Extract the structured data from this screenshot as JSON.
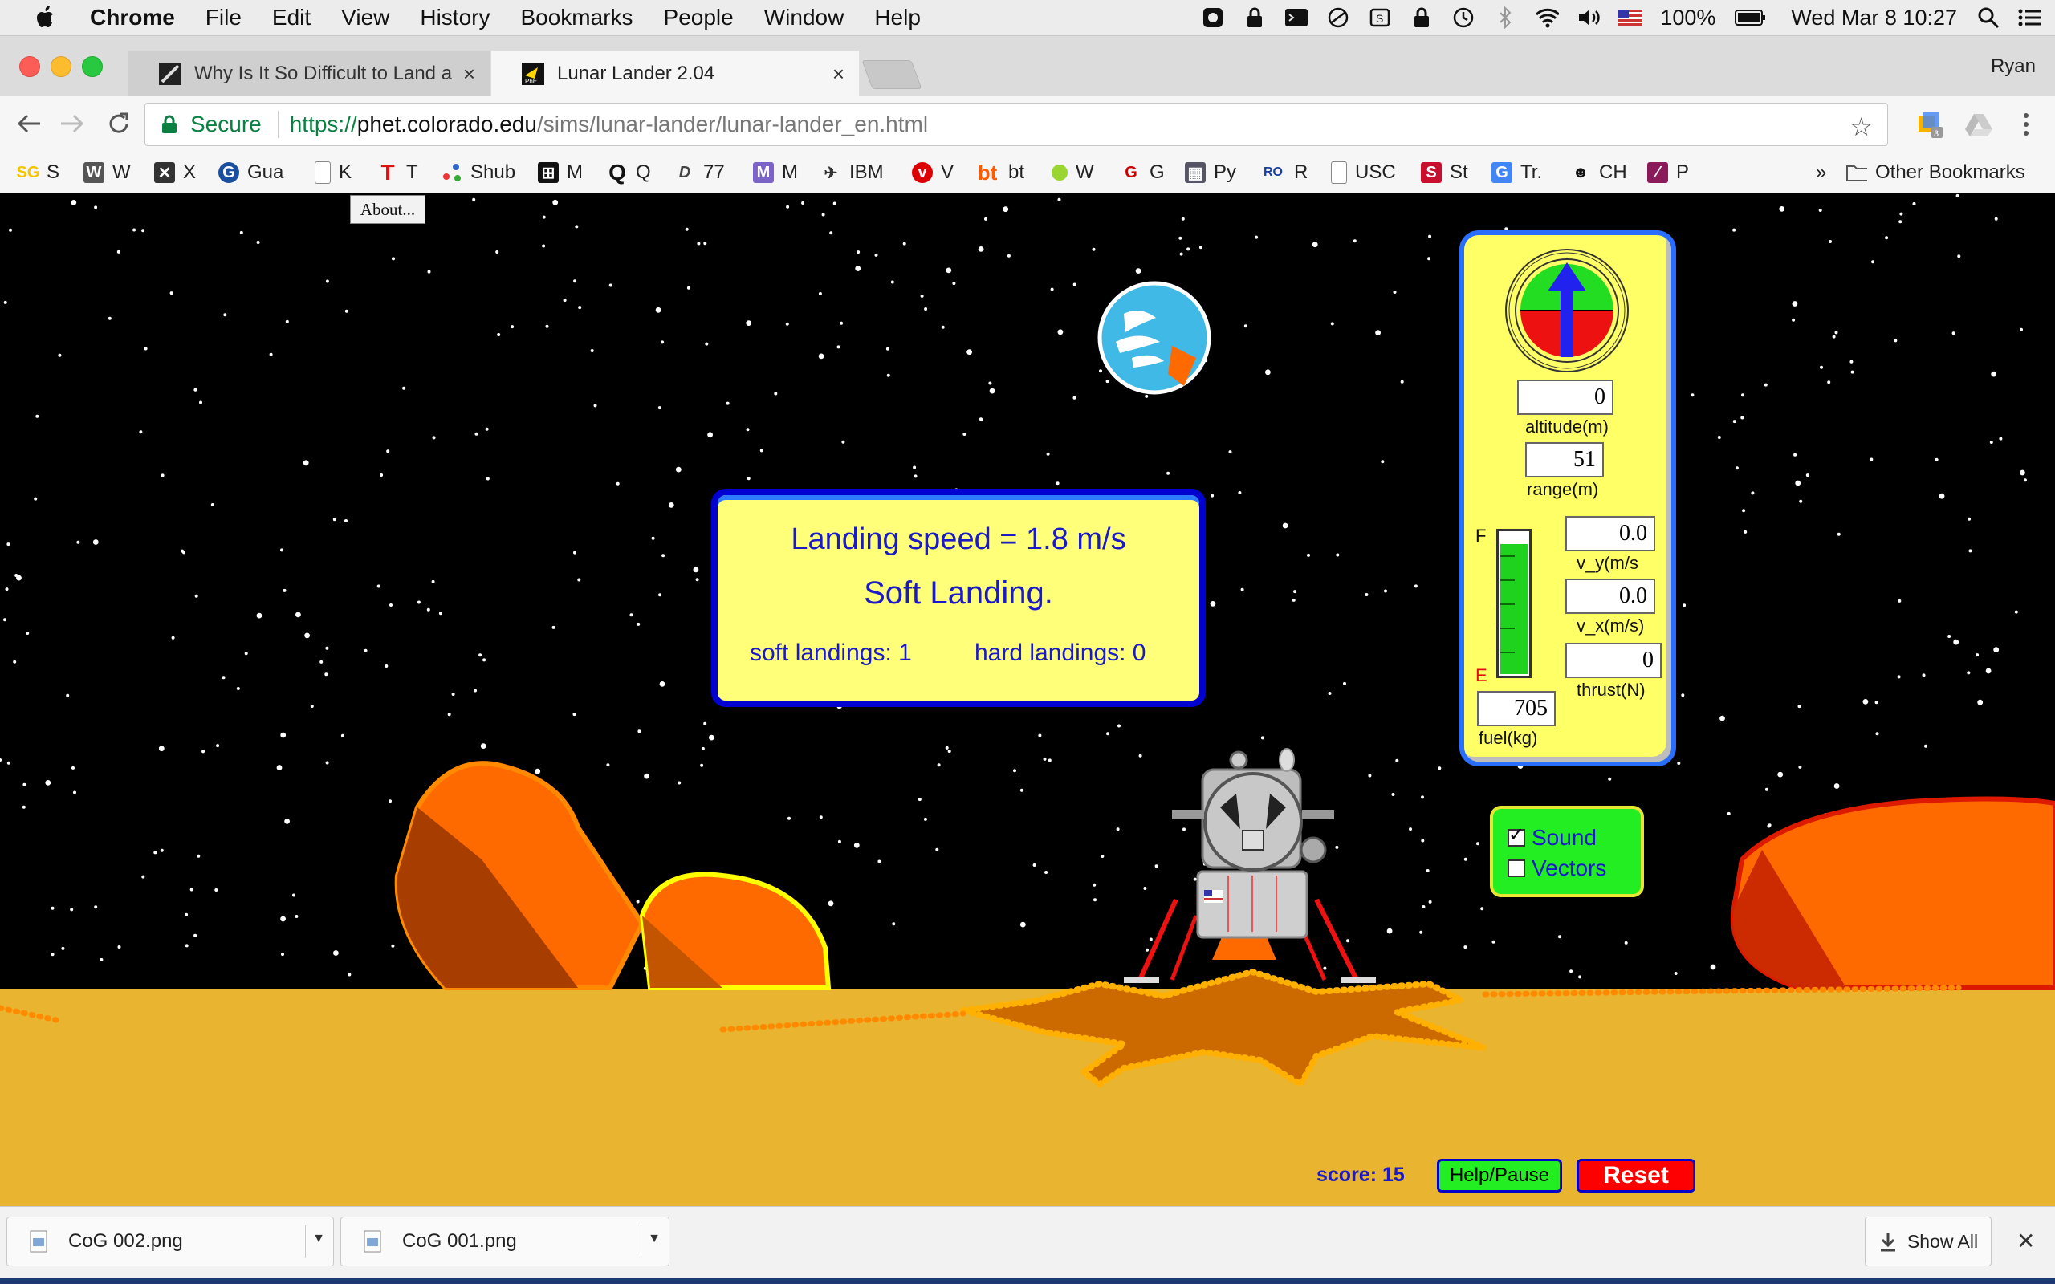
{
  "menubar": {
    "app": "Chrome",
    "items": [
      "File",
      "Edit",
      "View",
      "History",
      "Bookmarks",
      "People",
      "Window",
      "Help"
    ],
    "battery": "100%",
    "datetime": "Wed Mar 8  10:27"
  },
  "tabs": [
    {
      "title": "Why Is It So Difficult to Land a",
      "active": false
    },
    {
      "title": "Lunar Lander 2.04",
      "active": true
    }
  ],
  "profile": "Ryan",
  "omnibox": {
    "secure_label": "Secure",
    "scheme": "https://",
    "host": "phet.colorado.edu",
    "path": "/sims/lunar-lander/lunar-lander_en.html"
  },
  "bookmarks": [
    {
      "label": "S"
    },
    {
      "label": "W"
    },
    {
      "label": "X"
    },
    {
      "label": "Gua"
    },
    {
      "label": "K"
    },
    {
      "label": "T"
    },
    {
      "label": "Shub"
    },
    {
      "label": "M"
    },
    {
      "label": "Q"
    },
    {
      "label": "77"
    },
    {
      "label": "M"
    },
    {
      "label": "IBM"
    },
    {
      "label": "V"
    },
    {
      "label": "bt"
    },
    {
      "label": "W"
    },
    {
      "label": "G"
    },
    {
      "label": "Py"
    },
    {
      "label": "R"
    },
    {
      "label": "USC"
    },
    {
      "label": "St"
    },
    {
      "label": "Tr."
    },
    {
      "label": "CH"
    },
    {
      "label": "P"
    }
  ],
  "bookmarks_overflow": "»",
  "other_bookmarks": "Other Bookmarks",
  "sim": {
    "about_label": "About...",
    "result": {
      "speed": "Landing speed = 1.8 m/s",
      "verdict": "Soft Landing.",
      "soft": "soft landings: 1",
      "hard": "hard landings: 0"
    },
    "panel": {
      "altitude_value": "0",
      "altitude_label": "altitude(m)",
      "range_value": "51",
      "range_label": "range(m)",
      "vy_value": "0.0",
      "vy_label": "v_y(m/s",
      "vx_value": "0.0",
      "vx_label": "v_x(m/s)",
      "thrust_value": "0",
      "thrust_label": "thrust(N)",
      "fuel_value": "705",
      "fuel_label": "fuel(kg)",
      "fuel_full": "F",
      "fuel_empty": "E",
      "fuel_level": 0.92
    },
    "options": {
      "sound_label": "Sound",
      "sound_checked": true,
      "vectors_label": "Vectors",
      "vectors_checked": false
    },
    "score": "score: 15",
    "help_label": "Help/Pause",
    "reset_label": "Reset"
  },
  "downloads": {
    "items": [
      "CoG 002.png",
      "CoG 001.png"
    ],
    "show_all": "Show All"
  },
  "colors": {
    "sky": "#000000",
    "ground": "#e9b430",
    "panel": "#ffff66",
    "dialog_text": "#1a1ac8",
    "reset": "#ff0000",
    "help": "#22ee22"
  }
}
